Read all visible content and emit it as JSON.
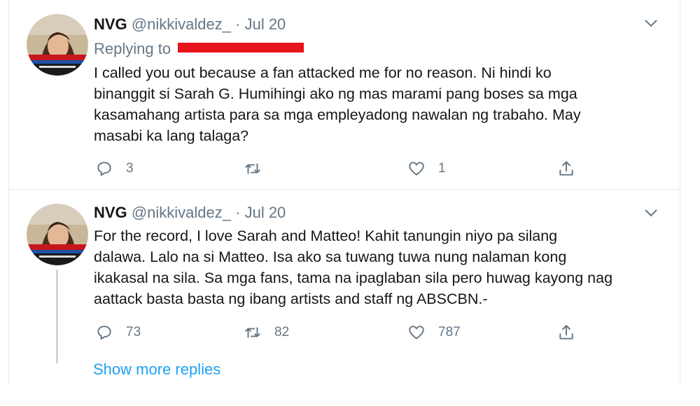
{
  "tweets": [
    {
      "author_name": "NVG",
      "handle": "@nikkivaldez_",
      "separator": "·",
      "date": "Jul 20",
      "replying_to_label": "Replying to",
      "text_lines": [
        "I called you out because a fan attacked me for no reason. Ni hindi ko",
        "binanggit si Sarah G. Humihingi ako ng mas marami pang boses sa mga",
        "kasamahang artista para sa mga empleyadong nawalan ng trabaho. May",
        "masabi ka lang talaga?"
      ],
      "reply_count": "3",
      "retweet_count": "",
      "like_count": "1"
    },
    {
      "author_name": "NVG",
      "handle": "@nikkivaldez_",
      "separator": "·",
      "date": "Jul 20",
      "text_lines": [
        "For the record, I love Sarah and Matteo! Kahit tanungin niyo pa silang",
        "dalawa. Lalo na si Matteo. Isa ako sa tuwang tuwa nung nalaman kong",
        "ikakasal na sila. Sa mga fans, tama na ipaglaban sila pero huwag kayong nag",
        "aattack basta basta ng ibang artists and staff ng ABSCBN.-"
      ],
      "reply_count": "73",
      "retweet_count": "82",
      "like_count": "787"
    }
  ],
  "show_more_label": "Show more replies",
  "colors": {
    "link": "#1da1f2",
    "secondary_text": "#657786",
    "redaction": "#e8141b",
    "divider": "#e6ecf0"
  },
  "icons": [
    "avatar",
    "chevron-down-icon",
    "reply-icon",
    "retweet-icon",
    "like-icon",
    "share-icon"
  ]
}
